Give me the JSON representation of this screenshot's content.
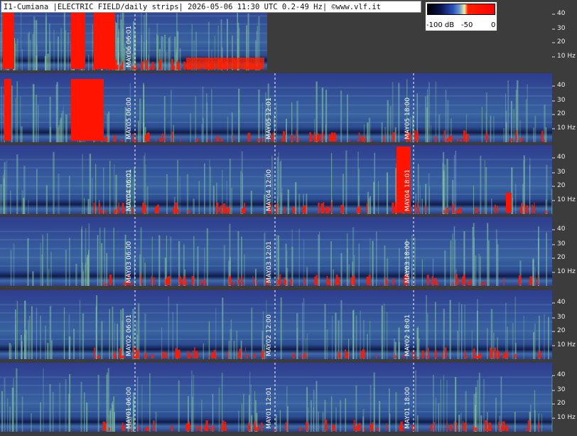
{
  "header": {
    "title": "I1-Cumiana |ELECTRIC FIELD/daily strips| 2026-05-06 11:30 UTC 0.2-49 Hz| ©www.vlf.it"
  },
  "colorbar": {
    "labels": [
      "-100 dB",
      "-50",
      "0"
    ],
    "colors": [
      "#000000",
      "#0b1650",
      "#2a50c0",
      "#6fa0c8",
      "#f0f0a0",
      "#ff0000"
    ]
  },
  "axis": {
    "ticks": [
      "40",
      "30",
      "20",
      "10 Hz"
    ]
  },
  "strips": [
    {
      "marks": [
        "MAY06 06:01"
      ]
    },
    {
      "marks": [
        "MAY05 06:00",
        "MAY05 12:01",
        "MAY05 18:00"
      ]
    },
    {
      "marks": [
        "MAY04 06:01",
        "MAY04 12:00",
        "MAY04 18:01"
      ]
    },
    {
      "marks": [
        "MAY03 06:00",
        "MAY03 12:01",
        "MAY03 18:00"
      ]
    },
    {
      "marks": [
        "MAY02 06:01",
        "MAY02 12:00",
        "MAY02 18:01"
      ]
    },
    {
      "marks": [
        "MAY01 06:00",
        "MAY01 12:01",
        "MAY01 18:00"
      ]
    }
  ]
}
